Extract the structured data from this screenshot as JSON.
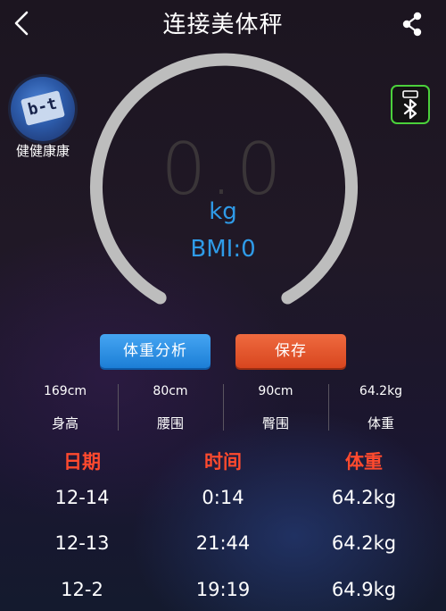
{
  "header": {
    "title": "连接美体秤"
  },
  "user": {
    "avatar_text": "b-t",
    "name": "健健康康"
  },
  "gauge": {
    "weight_value": "0.0",
    "unit": "kg",
    "bmi": "BMI:0",
    "colors": {
      "ring": "#bdbdbd",
      "accent": "#2f9be8"
    }
  },
  "actions": {
    "analyze_label": "体重分析",
    "save_label": "保存"
  },
  "stats": [
    {
      "value": "169cm",
      "label": "身高"
    },
    {
      "value": "80cm",
      "label": "腰围"
    },
    {
      "value": "90cm",
      "label": "臀围"
    },
    {
      "value": "64.2kg",
      "label": "体重"
    }
  ],
  "history": {
    "headers": {
      "date": "日期",
      "time": "时间",
      "weight": "体重"
    },
    "rows": [
      {
        "date": "12-14",
        "time": "0:14",
        "weight": "64.2kg"
      },
      {
        "date": "12-13",
        "time": "21:44",
        "weight": "64.2kg"
      },
      {
        "date": "12-2",
        "time": "19:19",
        "weight": "64.9kg"
      }
    ]
  }
}
